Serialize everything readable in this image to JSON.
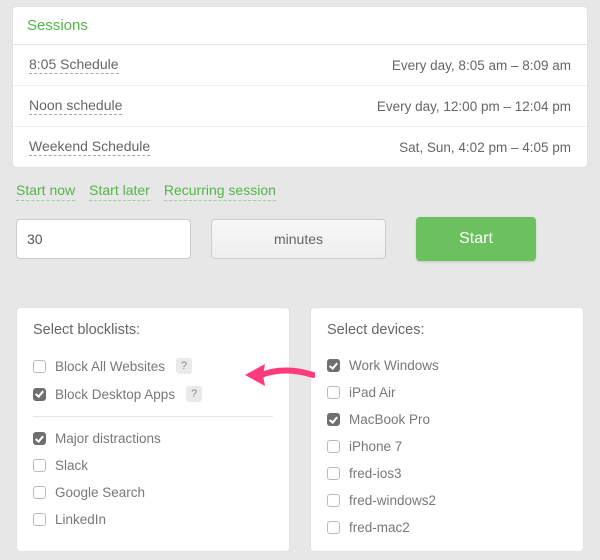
{
  "sessions": {
    "title": "Sessions",
    "items": [
      {
        "name": "8:05 Schedule",
        "time": "Every day, 8:05 am – 8:09 am"
      },
      {
        "name": "Noon schedule",
        "time": "Every day, 12:00 pm – 12:04 pm"
      },
      {
        "name": "Weekend Schedule",
        "time": "Sat, Sun, 4:02 pm – 4:05 pm"
      }
    ]
  },
  "tabs": {
    "start_now": "Start now",
    "start_later": "Start later",
    "recurring": "Recurring session"
  },
  "start": {
    "duration": "30",
    "units": "minutes",
    "button": "Start"
  },
  "blocklists": {
    "title": "Select blocklists:",
    "global": [
      {
        "label": "Block All Websites",
        "checked": false,
        "help": "?"
      },
      {
        "label": "Block Desktop Apps",
        "checked": true,
        "help": "?"
      }
    ],
    "items": [
      {
        "label": "Major distractions",
        "checked": true
      },
      {
        "label": "Slack",
        "checked": false
      },
      {
        "label": "Google Search",
        "checked": false
      },
      {
        "label": "LinkedIn",
        "checked": false
      }
    ]
  },
  "devices": {
    "title": "Select devices:",
    "items": [
      {
        "label": "Work Windows",
        "checked": true
      },
      {
        "label": "iPad Air",
        "checked": false
      },
      {
        "label": "MacBook Pro",
        "checked": true
      },
      {
        "label": "iPhone 7",
        "checked": false
      },
      {
        "label": "fred-ios3",
        "checked": false
      },
      {
        "label": "fred-windows2",
        "checked": false
      },
      {
        "label": "fred-mac2",
        "checked": false
      }
    ]
  }
}
